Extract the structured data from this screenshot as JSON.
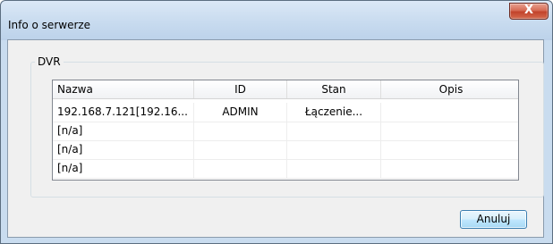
{
  "window": {
    "title": "Info o serwerze",
    "close_symbol": "X"
  },
  "group": {
    "label": "DVR"
  },
  "table": {
    "columns": [
      "Nazwa",
      "ID",
      "Stan",
      "Opis"
    ],
    "rows": [
      [
        "192.168.7.121[192.16...",
        "ADMIN",
        "Łączenie...",
        ""
      ],
      [
        "[n/a]",
        "",
        "",
        ""
      ],
      [
        "[n/a]",
        "",
        "",
        ""
      ],
      [
        "[n/a]",
        "",
        "",
        ""
      ]
    ]
  },
  "buttons": {
    "cancel_label": "Anuluj"
  },
  "colors": {
    "titlebar": "#c8dbef",
    "close_button": "#c2432b",
    "dialog_background": "#f0f0f0",
    "button_focus_border": "#3c7fb1"
  },
  "icons": [
    "close-icon"
  ]
}
